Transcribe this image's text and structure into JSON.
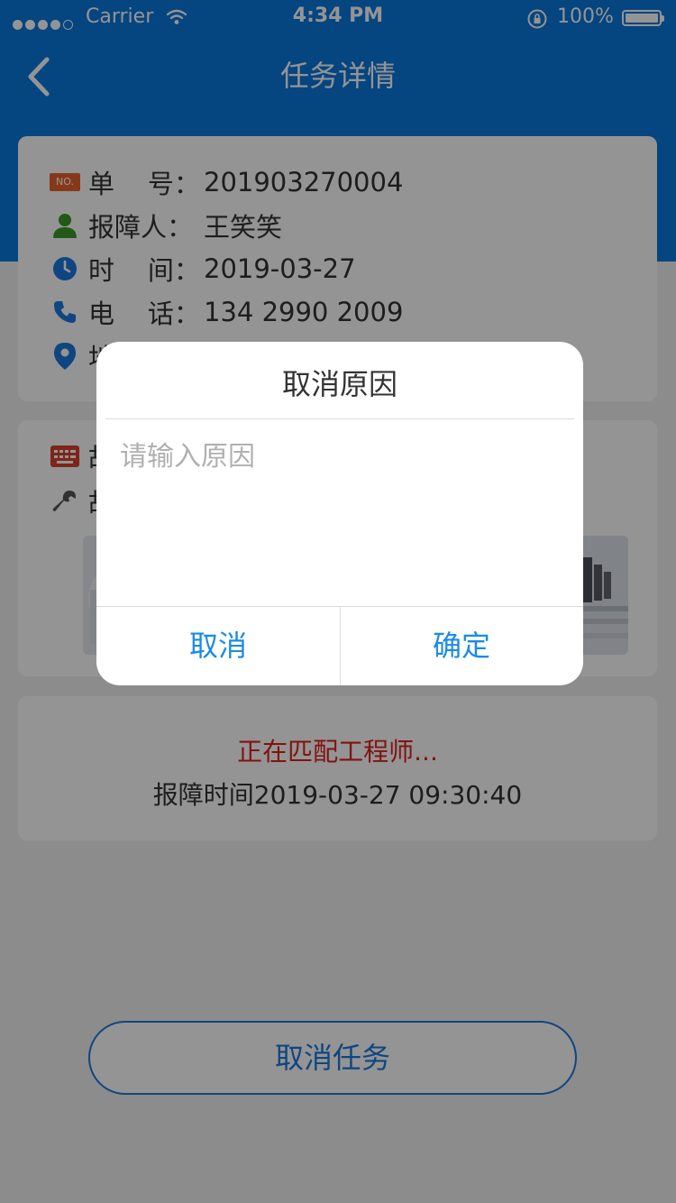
{
  "status_bar": {
    "carrier": "Carrier",
    "time": "4:34 PM",
    "battery": "100%"
  },
  "nav": {
    "title": "任务详情"
  },
  "order_info": {
    "rows": [
      {
        "label": "单    号：",
        "value": "201903270004",
        "icon": "no-badge-icon",
        "badge_text": "NO."
      },
      {
        "label": "报障人：",
        "value": "王笑笑",
        "icon": "person-icon"
      },
      {
        "label": "时    间：",
        "value": "2019-03-27",
        "icon": "clock-icon"
      },
      {
        "label": "电    话：",
        "value": "134 2990 2009",
        "icon": "phone-icon"
      },
      {
        "label": "地",
        "value": "",
        "icon": "location-pin-icon"
      }
    ]
  },
  "fault_info": {
    "rows": [
      {
        "label": "故",
        "icon": "keyboard-icon"
      },
      {
        "label": "故",
        "icon": "wrench-icon"
      }
    ]
  },
  "progress": {
    "status": "正在匹配工程师...",
    "report_time": "报障时间2019-03-27   09:30:40"
  },
  "actions": {
    "cancel_task": "取消任务"
  },
  "dialog": {
    "title": "取消原因",
    "placeholder": "请输入原因",
    "cancel": "取消",
    "confirm": "确定"
  },
  "colors": {
    "brand_blue": "#0a77dd",
    "accent_blue": "#1a8be8",
    "status_red": "#e0201a",
    "badge_orange": "#e8612c",
    "person_green": "#3b9a2c",
    "keyboard_red": "#d9412e"
  }
}
